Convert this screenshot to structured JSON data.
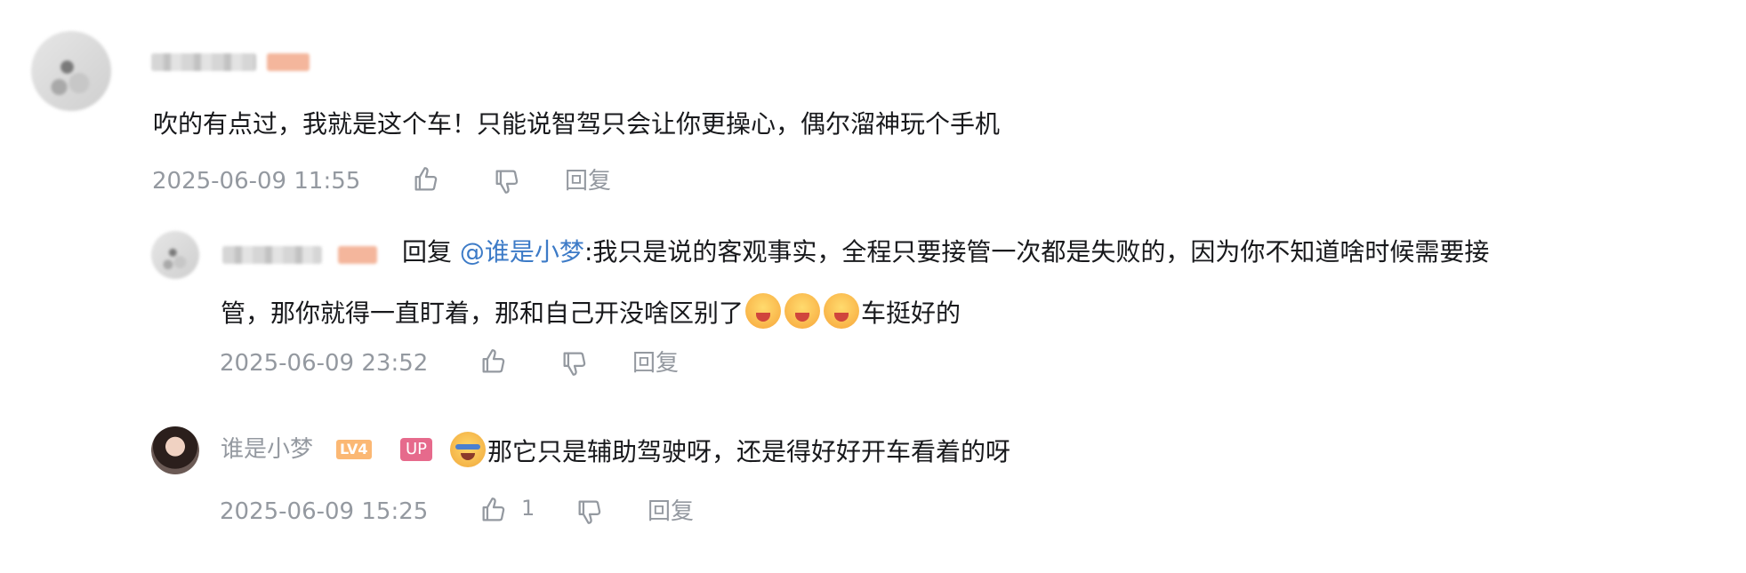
{
  "comment": {
    "text": "吹的有点过，我就是这个车！只能说智驾只会让你更操心，偶尔溜神玩个手机",
    "time": "2025-06-09 11:55",
    "reply_label": "回复"
  },
  "replies": [
    {
      "reply_prefix": "回复",
      "mention": "@谁是小梦",
      "text_line1": ":我只是说的客观事实，全程只要接管一次都是失败的，因为你不知道啥时候需要接",
      "text_line2": "管，那你就得一直盯着，那和自己开没啥区别了",
      "text_tail": "车挺好的",
      "time": "2025-06-09 23:52",
      "reply_label": "回复"
    },
    {
      "username": "谁是小梦",
      "level_badge": "LV4",
      "up_badge": "UP",
      "text": "那它只是辅助驾驶呀，还是得好好开车看着的呀",
      "time": "2025-06-09 15:25",
      "like_count": "1",
      "reply_label": "回复"
    }
  ],
  "icons": {
    "like": "thumbs-up-icon",
    "dislike": "thumbs-down-icon"
  },
  "colors": {
    "link": "#3d7bc7",
    "meta": "#9499a0",
    "up_badge": "#e66a8c",
    "level_badge": "#fbb874"
  }
}
